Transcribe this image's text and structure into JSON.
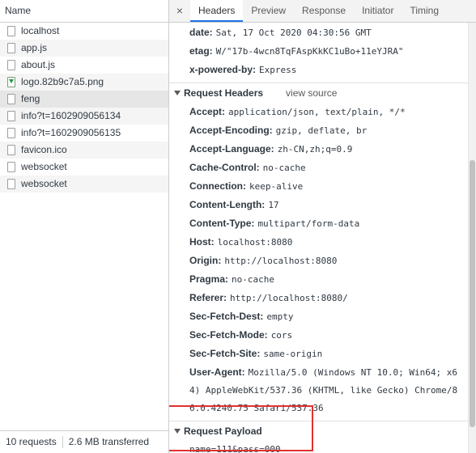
{
  "left": {
    "header": "Name",
    "requests": [
      {
        "name": "localhost",
        "icon": "document-icon"
      },
      {
        "name": "app.js",
        "icon": "script-file-icon"
      },
      {
        "name": "about.js",
        "icon": "script-file-icon"
      },
      {
        "name": "logo.82b9c7a5.png",
        "icon": "image-file-icon"
      },
      {
        "name": "feng",
        "icon": "xhr-file-icon"
      },
      {
        "name": "info?t=1602909056134",
        "icon": "xhr-file-icon"
      },
      {
        "name": "info?t=1602909056135",
        "icon": "xhr-file-icon"
      },
      {
        "name": "favicon.ico",
        "icon": "image-file-icon"
      },
      {
        "name": "websocket",
        "icon": "websocket-icon"
      },
      {
        "name": "websocket",
        "icon": "websocket-icon"
      }
    ],
    "status": {
      "requests": "10 requests",
      "transferred": "2.6 MB transferred"
    }
  },
  "tabs": {
    "close": "×",
    "items": [
      "Headers",
      "Preview",
      "Response",
      "Initiator",
      "Timing"
    ],
    "active": "Headers"
  },
  "response_headers": [
    {
      "k": "date:",
      "v": "Sat, 17 Oct 2020 04:30:56 GMT"
    },
    {
      "k": "etag:",
      "v": "W/\"17b-4wcn8TqFAspKkKC1uBo+11eYJRA\""
    },
    {
      "k": "x-powered-by:",
      "v": "Express"
    }
  ],
  "request_headers": {
    "title": "Request Headers",
    "view_source": "view source",
    "rows": [
      {
        "k": "Accept:",
        "v": "application/json, text/plain, */*"
      },
      {
        "k": "Accept-Encoding:",
        "v": "gzip, deflate, br"
      },
      {
        "k": "Accept-Language:",
        "v": "zh-CN,zh;q=0.9"
      },
      {
        "k": "Cache-Control:",
        "v": "no-cache"
      },
      {
        "k": "Connection:",
        "v": "keep-alive"
      },
      {
        "k": "Content-Length:",
        "v": "17"
      },
      {
        "k": "Content-Type:",
        "v": "multipart/form-data"
      },
      {
        "k": "Host:",
        "v": "localhost:8080"
      },
      {
        "k": "Origin:",
        "v": "http://localhost:8080"
      },
      {
        "k": "Pragma:",
        "v": "no-cache"
      },
      {
        "k": "Referer:",
        "v": "http://localhost:8080/"
      },
      {
        "k": "Sec-Fetch-Dest:",
        "v": "empty"
      },
      {
        "k": "Sec-Fetch-Mode:",
        "v": "cors"
      },
      {
        "k": "Sec-Fetch-Site:",
        "v": "same-origin"
      }
    ],
    "user_agent": {
      "k": "User-Agent:",
      "v1": "Mozilla/5.0 (Windows NT 10.0; Win64; x6",
      "v2": "4) AppleWebKit/537.36 (KHTML, like Gecko) Chrome/8",
      "v3": "6.0.4240.75 Safari/537.36"
    }
  },
  "payload": {
    "title": "Request Payload",
    "value": "name=111&pass=000"
  },
  "colors": {
    "accent": "#1a73e8",
    "highlight_box": "#e03131"
  }
}
